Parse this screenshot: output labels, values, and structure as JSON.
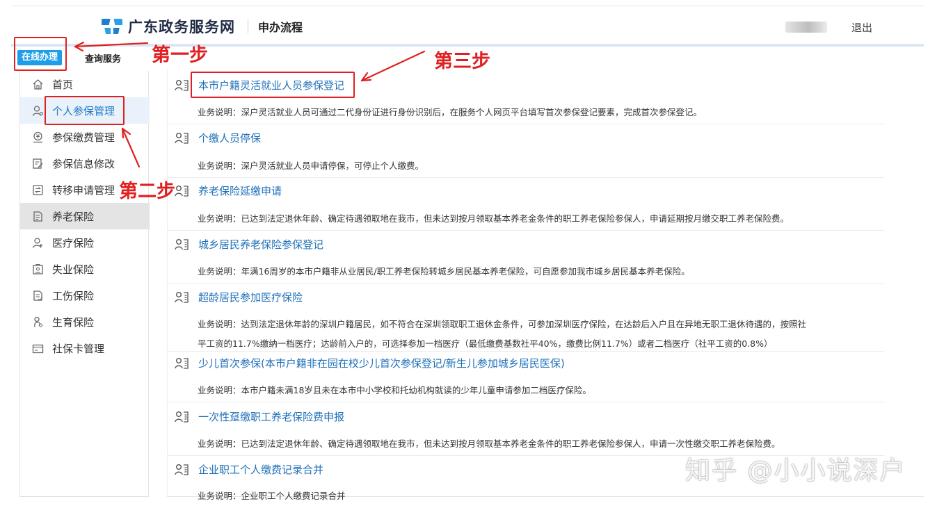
{
  "header": {
    "site_name": "广东政务服务网",
    "subtitle": "申办流程",
    "logout_label": "退出"
  },
  "tabs": {
    "online": "在线办理",
    "query": "查询服务"
  },
  "sidebar": {
    "items": [
      {
        "label": "首页",
        "icon": "home-icon"
      },
      {
        "label": "个人参保管理",
        "icon": "person-icon"
      },
      {
        "label": "参保缴费管理",
        "icon": "payment-icon"
      },
      {
        "label": "参保信息修改",
        "icon": "edit-icon"
      },
      {
        "label": "转移申请管理",
        "icon": "transfer-icon"
      },
      {
        "label": "养老保险",
        "icon": "document-icon"
      },
      {
        "label": "医疗保险",
        "icon": "medical-icon"
      },
      {
        "label": "失业保险",
        "icon": "unemployment-icon"
      },
      {
        "label": "工伤保险",
        "icon": "injury-icon"
      },
      {
        "label": "生育保险",
        "icon": "maternity-icon"
      },
      {
        "label": "社保卡管理",
        "icon": "card-icon"
      }
    ]
  },
  "services": [
    {
      "name": "本市户籍灵活就业人员参保登记",
      "desc": [
        "业务说明：深户灵活就业人员可通过二代身份证进行身份识别后，在服务个人网页平台填写首次参保登记要素，完成首次参保登记。"
      ]
    },
    {
      "name": "个缴人员停保",
      "desc": [
        "业务说明：深户灵活就业人员申请停保，可停止个人缴费。"
      ]
    },
    {
      "name": "养老保险延缴申请",
      "desc": [
        "业务说明：已达到法定退休年龄、确定待遇领取地在我市，但未达到按月领取基本养老金条件的职工养老保险参保人，申请延期按月缴交职工养老保险费。"
      ]
    },
    {
      "name": "城乡居民养老保险参保登记",
      "desc": [
        "业务说明：年满16周岁的本市户籍非从业居民/职工养老保险转城乡居民基本养老保险，可自愿参加我市城乡居民基本养老保险。"
      ]
    },
    {
      "name": "超龄居民参加医疗保险",
      "desc": [
        "业务说明：达到法定退休年龄的深圳户籍居民，如不符合在深圳领取职工退休金条件，可参加深圳医疗保险，在达龄后入户且在异地无职工退休待遇的，按照社",
        "平工资的11.7%缴纳一档医疗；达龄前入户的，可选择参加一档医疗（最低缴费基数社平40%，缴费比例11.7%）或者二档医疗（社平工资的0.8%）"
      ]
    },
    {
      "name": "少儿首次参保(本市户籍非在园在校少儿首次参保登记/新生儿参加城乡居民医保)",
      "desc": [
        "业务说明：本市户籍未满18岁且未在本市中小学校和托幼机构就读的少年儿童申请参加二档医疗保险。"
      ]
    },
    {
      "name": "一次性趸缴职工养老保险费申报",
      "desc": [
        "业务说明：已达到法定退休年龄、确定待遇领取地在我市，但未达到按月领取基本养老金条件的职工养老保险参保人，申请一次性缴交职工养老保险费。"
      ]
    },
    {
      "name": "企业职工个人缴费记录合并",
      "desc": [
        "业务说明：企业职工个人缴费记录合并"
      ]
    }
  ],
  "annotations": {
    "step1": "第一步",
    "step2": "第二步",
    "step3": "第三步",
    "color": "#e02020"
  },
  "watermark": "知乎 @小小说深户",
  "colors": {
    "accent": "#1e9ee8",
    "link": "#1e6fb8",
    "active_bg": "#e9f1fb",
    "selected_gray": "#e4e4e4"
  }
}
